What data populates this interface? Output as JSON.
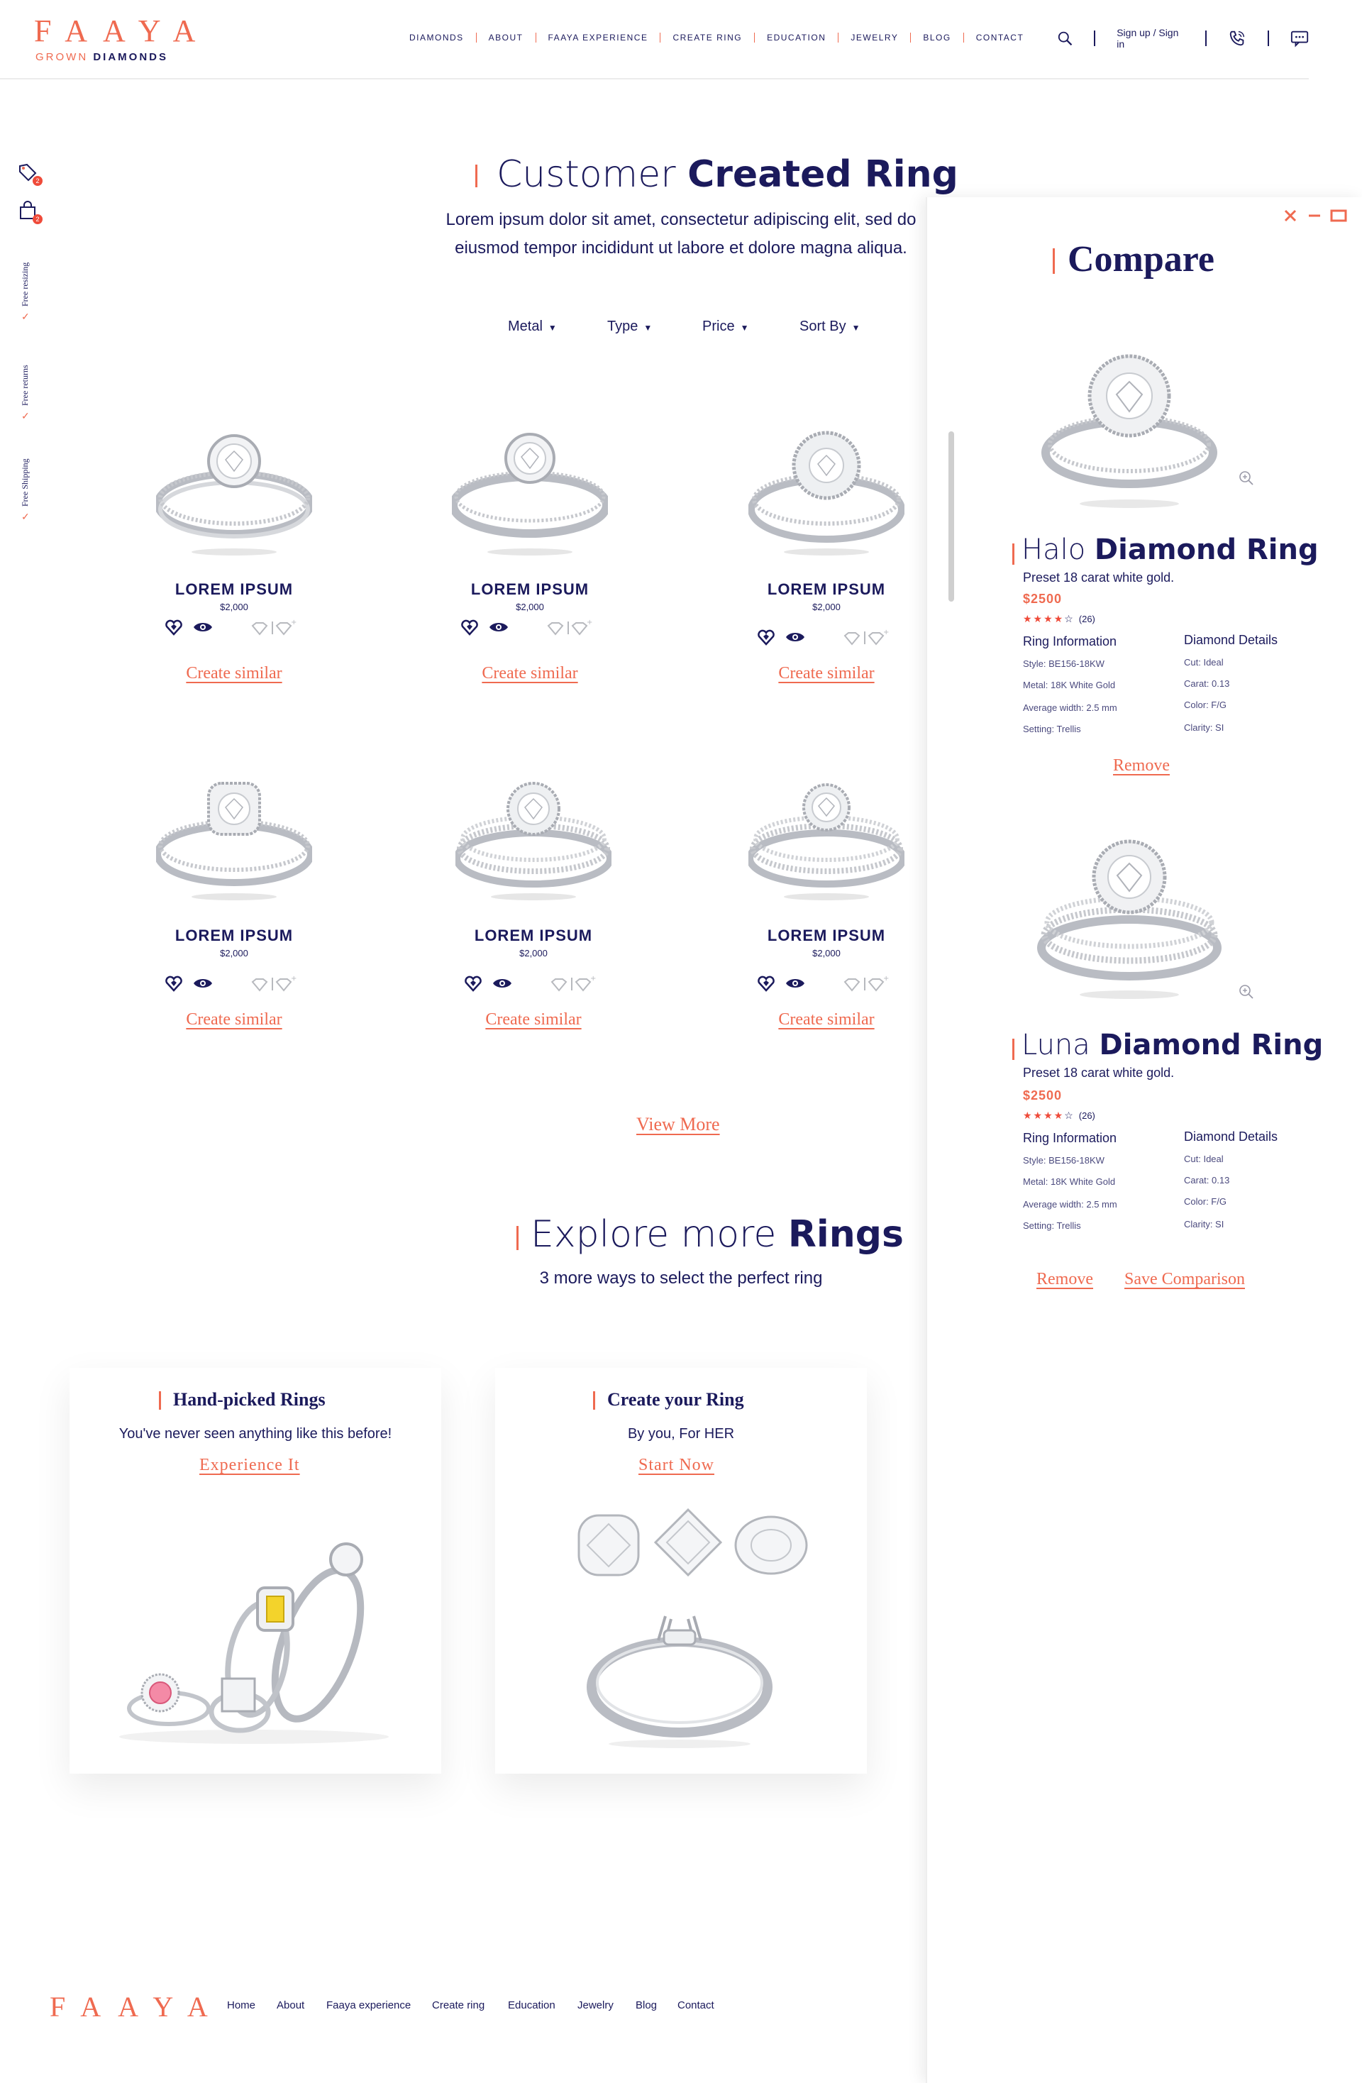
{
  "header": {
    "logo": "FAAYA",
    "logo_sub_light": "GROWN",
    "logo_sub_bold": "DIAMONDS",
    "nav": [
      "DIAMONDS",
      "ABOUT",
      "FAAYA EXPERIENCE",
      "CREATE RING",
      "EDUCATION",
      "JEWELRY",
      "BLOG",
      "CONTACT"
    ],
    "signin": "Sign up / Sign in"
  },
  "side": {
    "wishlist_count": "2",
    "cart_count": "2",
    "perks": [
      "Free resizing",
      "Free returns",
      "Free Shipping"
    ]
  },
  "main": {
    "title_light": "Customer",
    "title_bold": "Created Ring",
    "subtitle_line1": "Lorem ipsum dolor sit amet, consectetur adipiscing elit, sed do",
    "subtitle_line2": "eiusmod tempor incididunt ut labore et dolore magna aliqua.",
    "filters": [
      "Metal",
      "Type",
      "Price",
      "Sort By"
    ],
    "products": [
      {
        "name": "LOREM IPSUM",
        "price": "$2,000",
        "cta": "Create similar"
      },
      {
        "name": "LOREM IPSUM",
        "price": "$2,000",
        "cta": "Create similar"
      },
      {
        "name": "LOREM IPSUM",
        "price": "$2,000",
        "cta": "Create similar"
      },
      {
        "name": "LOREM IPSUM",
        "price": "$2,000",
        "cta": "Create similar"
      },
      {
        "name": "LOREM IPSUM",
        "price": "$2,000",
        "cta": "Create similar"
      },
      {
        "name": "LOREM IPSUM",
        "price": "$2,000",
        "cta": "Create similar"
      }
    ],
    "view_more": "View More"
  },
  "explore": {
    "title_light": "Explore more",
    "title_bold": "Rings",
    "subtitle": "3 more ways to select the perfect ring",
    "boxes": [
      {
        "title": "Hand-picked Rings",
        "sub": "You've never seen anything like this before!",
        "cta": "Experience It"
      },
      {
        "title": "Create your Ring",
        "sub": "By you, For HER",
        "cta": "Start Now"
      }
    ]
  },
  "compare": {
    "title": "Compare",
    "items": [
      {
        "name_light": "Halo",
        "name_bold": "Diamond Ring",
        "desc": "Preset 18 carat white gold.",
        "price": "$2500",
        "rating": 4,
        "reviews": "(26)",
        "info_head": "Ring Information",
        "info": [
          "Style: BE156-18KW",
          "Metal: 18K White Gold",
          "Average width: 2.5 mm",
          "Setting: Trellis"
        ],
        "details_head": "Diamond Details",
        "details": [
          "Cut: Ideal",
          "Carat: 0.13",
          "Color: F/G",
          "Clarity: SI"
        ],
        "remove": "Remove"
      },
      {
        "name_light": "Luna",
        "name_bold": "Diamond Ring",
        "desc": "Preset 18 carat white gold.",
        "price": "$2500",
        "rating": 4,
        "reviews": "(26)",
        "info_head": "Ring Information",
        "info": [
          "Style: BE156-18KW",
          "Metal: 18K White Gold",
          "Average width: 2.5 mm",
          "Setting: Trellis"
        ],
        "details_head": "Diamond Details",
        "details": [
          "Cut: Ideal",
          "Carat: 0.13",
          "Color: F/G",
          "Clarity: SI"
        ],
        "remove": "Remove"
      }
    ],
    "save": "Save Comparison"
  },
  "footer": {
    "logo": "FAAYA",
    "links": [
      "Home",
      "About",
      "Faaya experience",
      "Create ring",
      "Education",
      "Jewelry",
      "Blog",
      "Contact"
    ]
  },
  "colors": {
    "navy": "#1b1a5c",
    "coral": "#ef6a50",
    "badge": "#ef4b3a"
  }
}
